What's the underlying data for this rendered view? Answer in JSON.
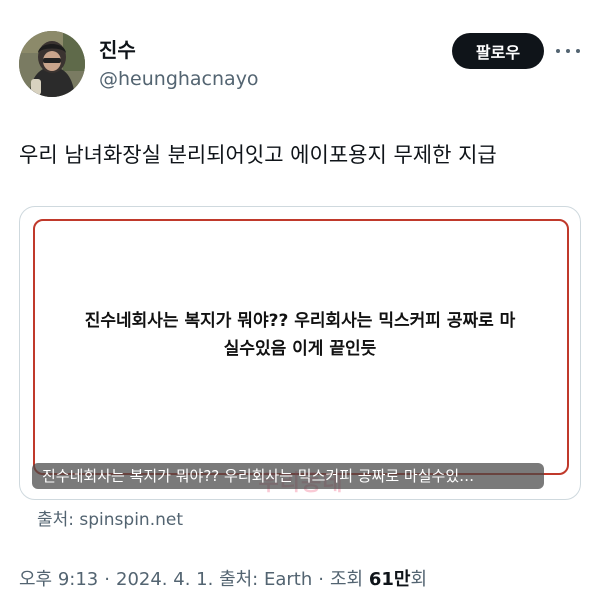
{
  "author": {
    "name": "진수",
    "handle": "@heunghacnayo",
    "avatar_icon": "profile-photo"
  },
  "header": {
    "follow_label": "팔로우",
    "more_icon": "more-horizontal-icon"
  },
  "tweet": {
    "text": "우리 남녀화장실 분리되어잇고 에이포용지 무제한 지급"
  },
  "card": {
    "body_line1": "진수네회사는 복지가 뭐야?? 우리회사는 믹스커피 공짜로 마",
    "body_line2": "실수있음 이게 끝인듯",
    "watermark": "우리동네",
    "caption": "진수네회사는 복지가 뭐야?? 우리회사는 믹스커피 공짜로 마실수있…",
    "frame_color": "#c0392b"
  },
  "source": {
    "label": "출처: spinspin.net"
  },
  "meta": {
    "time": "오후 9:13",
    "date": "2024. 4. 1.",
    "location": "출처: Earth",
    "views_label": "조회",
    "views_count": "61만",
    "views_suffix": "회",
    "separator": "·"
  },
  "colors": {
    "text_primary": "#0f1419",
    "text_secondary": "#536471",
    "button_bg": "#0f1419",
    "border": "#cfd9de"
  }
}
